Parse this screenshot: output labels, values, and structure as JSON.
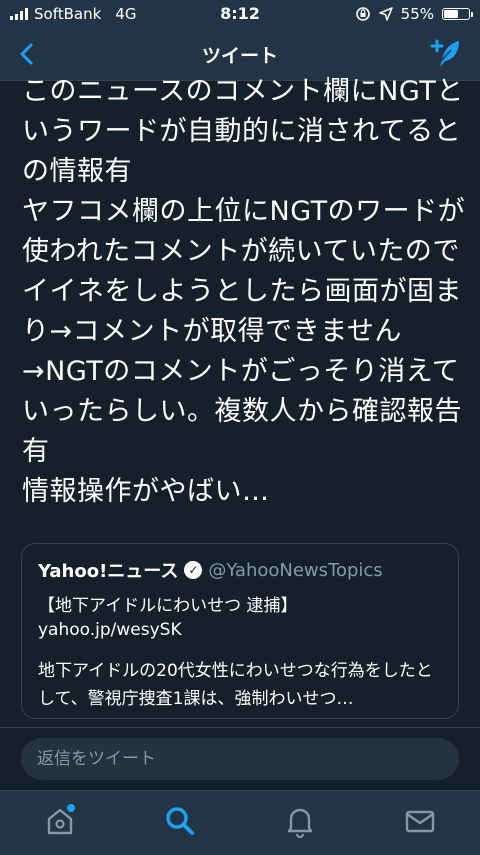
{
  "status_bar": {
    "carrier": "SoftBank",
    "network": "4G",
    "time": "8:12",
    "battery": "55%",
    "battery_level": 0.55
  },
  "header": {
    "title": "ツイート"
  },
  "tweet": {
    "text": "このニュースのコメント欄にNGTというワードが自動的に消されてるとの情報有\nヤフコメ欄の上位にNGTのワードが使われたコメントが続いていたのでイイネをしようとしたら画面が固まり→コメントが取得できません→NGTのコメントがごっそり消えていったらしい。複数人から確認報告有\n情報操作がやばい…"
  },
  "quote": {
    "name": "Yahoo!ニュース",
    "handle": "@YahooNewsTopics",
    "headline": "【地下アイドルにわいせつ 逮捕】",
    "link": "yahoo.jp/wesySK",
    "summary": "地下アイドルの20代女性にわいせつな行為をしたとして、警視庁捜査1課は、強制わいせつ…"
  },
  "reply": {
    "placeholder": "返信をツイート"
  },
  "tabs": [
    "home-icon",
    "search-icon",
    "notifications-icon",
    "messages-icon"
  ],
  "colors": {
    "background": "#15202b",
    "bar": "#243447",
    "accent": "#1da1f2",
    "secondary": "#8899a6"
  }
}
